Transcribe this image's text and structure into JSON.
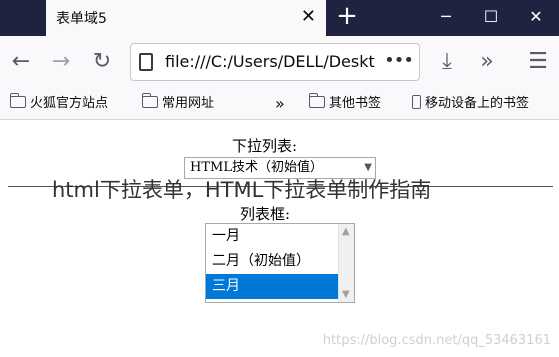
{
  "browser": {
    "tab_title": "表单域5",
    "tab_close_icon": "close-icon",
    "new_tab_icon": "plus-icon",
    "window_controls": {
      "minimize": "─",
      "maximize": "☐",
      "close": "✕"
    },
    "url": "file:///C:/Users/DELL/Deskt",
    "url_menu": "•••",
    "nav": {
      "back": "←",
      "forward": "→",
      "reload": "↻",
      "download": "⤓",
      "more": "»",
      "menu": "☰"
    }
  },
  "bookmarks": {
    "items": [
      {
        "label": "火狐官方站点"
      },
      {
        "label": "常用网址"
      }
    ],
    "overflow": "»",
    "other": "其他书签",
    "mobile": "移动设备上的书签"
  },
  "page": {
    "dropdown_label": "下拉列表:",
    "dropdown_selected": "HTML技术（初始值）",
    "listbox_label": "列表框:",
    "listbox_options": [
      "一月",
      "二月（初始值）",
      "三月"
    ],
    "listbox_selected_index": 2
  },
  "overlay": {
    "title": "html下拉表单，HTML下拉表单制作指南",
    "watermark": "https://blog.csdn.net/qq_53463161"
  },
  "colors": {
    "tabbar": "#202340",
    "selection": "#0078d7"
  }
}
